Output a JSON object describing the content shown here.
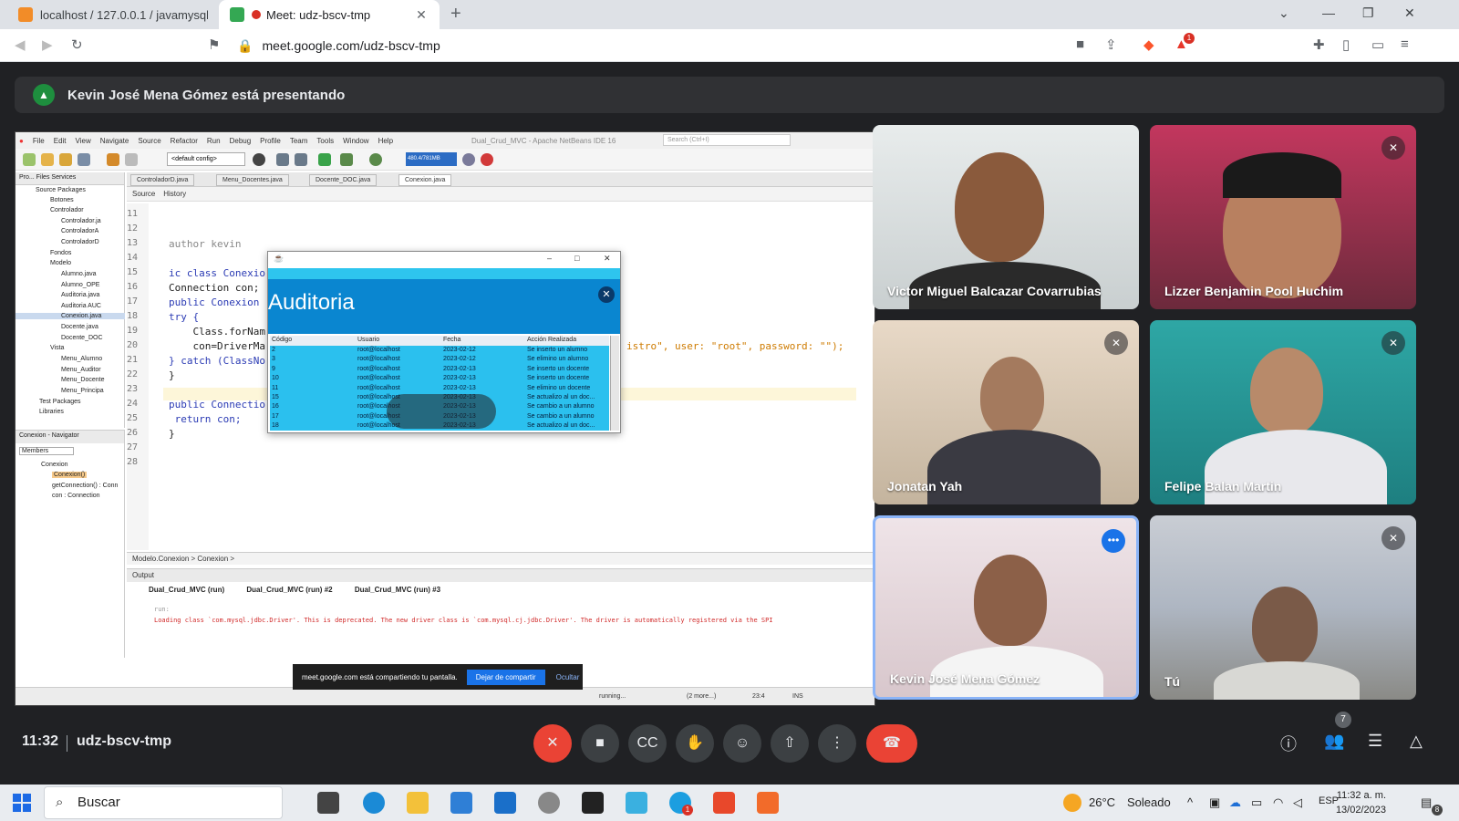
{
  "browser": {
    "tabs": [
      {
        "label": "localhost / 127.0.0.1 / javamysql | php"
      },
      {
        "label": "Meet: udz-bscv-tmp"
      }
    ],
    "url": "meet.google.com/udz-bscv-tmp",
    "ext_badge": "1"
  },
  "banner": {
    "presenting": "Kevin José Mena Gómez está presentando"
  },
  "netbeans": {
    "menu": [
      "File",
      "Edit",
      "View",
      "Navigate",
      "Source",
      "Refactor",
      "Run",
      "Debug",
      "Profile",
      "Team",
      "Tools",
      "Window",
      "Help"
    ],
    "title": "Dual_Crud_MVC - Apache NetBeans IDE 16",
    "search_placeholder": "Search (Ctrl+I)",
    "config": "<default config>",
    "memory": "480.4/781MB",
    "project_tabs": "Pro...  Files  Services",
    "project_tree": [
      "Source Packages",
      "Botones",
      "Controlador",
      "Controlador.ja",
      "ControladorA",
      "ControladorD",
      "Fondos",
      "Modelo",
      "Alumno.java",
      "Alumno_OPE",
      "Auditoria.java",
      "Auditoria AUC",
      "Conexion.java",
      "Docente.java",
      "Docente_DOC",
      "Vista",
      "Menu_Alumno",
      "Menu_Auditor",
      "Menu_Docente",
      "Menu_Principa",
      "Test Packages",
      "Libraries"
    ],
    "navigator_title": "Conexion - Navigator",
    "navigator_filter": "Members",
    "navigator_items": [
      "Conexion",
      "Conexion()",
      "getConnection() : Conn",
      "con : Connection"
    ],
    "editor_tabs": [
      "ControladorD.java",
      "Menu_Docentes.java",
      "Docente_DOC.java",
      "Conexion.java"
    ],
    "source_tab": "Source",
    "history_tab": "History",
    "line_numbers": [
      "11",
      "12",
      "13",
      "14",
      "15",
      "16",
      "17",
      "18",
      "19",
      "20",
      "21",
      "22",
      "23",
      "24",
      "25",
      "26",
      "27",
      "28"
    ],
    "code_lines": [
      {
        "kind": "cm",
        "text": "author kevin"
      },
      {
        "kind": "kw",
        "text": "ic class Conexio"
      },
      {
        "kind": "pl",
        "text": "Connection con;"
      },
      {
        "kind": "kw",
        "text": "public Conexion"
      },
      {
        "kind": "pl",
        "text": "try {"
      },
      {
        "kind": "pl",
        "text": "    Class.forNam"
      },
      {
        "kind": "pl",
        "text": "    con=DriverMa"
      },
      {
        "kind": "pl",
        "text": "} catch (ClassNo"
      },
      {
        "kind": "pl",
        "text": "}"
      },
      {
        "kind": "kw",
        "text": "public Connectio"
      },
      {
        "kind": "pl",
        "text": " return con;"
      },
      {
        "kind": "pl",
        "text": "}"
      }
    ],
    "code_tail": "istro\", user: \"root\", password: \"\");",
    "breadcrumb": "Modelo.Conexion  >  Conexion  >",
    "output_title": "Output",
    "output_tabs": [
      "Dual_Crud_MVC (run)",
      "Dual_Crud_MVC (run) #2",
      "Dual_Crud_MVC (run) #3"
    ],
    "output_run": "run:",
    "output_warning": "Loading class `com.mysql.jdbc.Driver'. This is deprecated. The new driver class is `com.mysql.cj.jdbc.Driver'. The driver is automatically registered via the SPI",
    "status_running": "running...",
    "status_more": "(2 more...)",
    "status_pos": "23:4",
    "status_mode": "INS"
  },
  "share_bar": {
    "text": "meet.google.com está compartiendo tu pantalla.",
    "stop": "Dejar de compartir",
    "hide": "Ocultar"
  },
  "auditoria": {
    "title": "Auditoria",
    "columns": [
      "Código",
      "Usuario",
      "Fecha",
      "Acción Realizada"
    ],
    "rows": [
      [
        "2",
        "root@localhost",
        "2023-02-12",
        "Se inserto un alumno"
      ],
      [
        "3",
        "root@localhost",
        "2023-02-12",
        "Se elimino un alumno"
      ],
      [
        "9",
        "root@localhost",
        "2023-02-13",
        "Se inserto un docente"
      ],
      [
        "10",
        "root@localhost",
        "2023-02-13",
        "Se inserto un docente"
      ],
      [
        "11",
        "root@localhost",
        "2023-02-13",
        "Se elimino un docente"
      ],
      [
        "15",
        "root@localhost",
        "2023-02-13",
        "Se actualizo al un doc..."
      ],
      [
        "16",
        "root@localhost",
        "2023-02-13",
        "Se cambio a un alumno"
      ],
      [
        "17",
        "root@localhost",
        "2023-02-13",
        "Se cambio a un alumno"
      ],
      [
        "18",
        "root@localhost",
        "2023-02-13",
        "Se actualizo al un doc..."
      ]
    ]
  },
  "participants": [
    {
      "name": "Victor Miguel Balcazar Covarrubias",
      "muted": false
    },
    {
      "name": "Lizzer Benjamin Pool Huchim",
      "muted": true
    },
    {
      "name": "Jonatan Yah",
      "muted": true
    },
    {
      "name": "Felipe Balan Martin",
      "muted": true
    },
    {
      "name": "Kevin José Mena Gómez",
      "muted": false
    },
    {
      "name": "Tú",
      "muted": true
    }
  ],
  "meeting": {
    "time": "11:32",
    "code": "udz-bscv-tmp",
    "people_count": "7"
  },
  "taskbar": {
    "search": "Buscar",
    "weather_temp": "26°C",
    "weather_text": "Soleado",
    "lang": "ESP",
    "clock_time": "11:32 a. m.",
    "clock_date": "13/02/2023",
    "notif_count": "8",
    "skype_badge": "1"
  }
}
